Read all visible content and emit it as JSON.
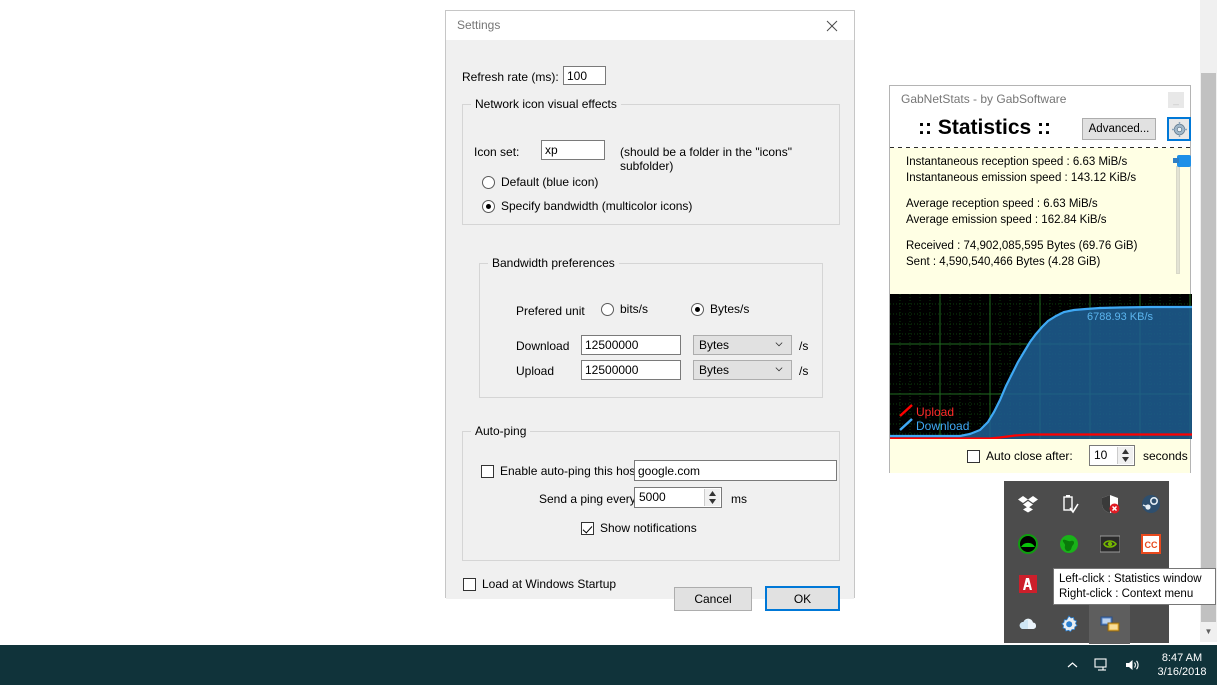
{
  "settings_dialog": {
    "title": "Settings",
    "close_icon": "close-icon",
    "refresh_rate_label": "Refresh rate (ms):",
    "refresh_rate_value": "100",
    "network_group": {
      "title": "Network icon visual effects",
      "icon_set_label": "Icon set:",
      "icon_set_value": "xp",
      "icon_set_hint": "(should be a folder in the \"icons\" subfolder)",
      "radio_default_label": "Default (blue icon)",
      "radio_specify_label": "Specify bandwidth (multicolor icons)",
      "selected": "specify"
    },
    "bandwidth_group": {
      "title": "Bandwidth preferences",
      "preferred_unit_label": "Prefered unit",
      "unit_bits_label": "bits/s",
      "unit_bytes_label": "Bytes/s",
      "unit_selected": "bytes",
      "download_label": "Download",
      "download_value": "12500000",
      "download_unit": "Bytes",
      "download_suffix": "/s",
      "upload_label": "Upload",
      "upload_value": "12500000",
      "upload_unit": "Bytes",
      "upload_suffix": "/s"
    },
    "autoping_group": {
      "title": "Auto-ping",
      "enable_label": "Enable auto-ping this host:",
      "enable_checked": false,
      "host_value": "google.com",
      "interval_label": "Send a ping every",
      "interval_value": "5000",
      "interval_unit": "ms",
      "notifications_label": "Show notifications",
      "notifications_checked": true
    },
    "footer": {
      "startup_label": "Load at Windows Startup",
      "startup_checked": false,
      "cancel_label": "Cancel",
      "ok_label": "OK"
    }
  },
  "stats_window": {
    "titlebar": "GabNetStats - by GabSoftware",
    "minimize_icon": "minimize-icon",
    "heading": ":: Statistics ::",
    "advanced_label": "Advanced...",
    "settings_icon": "gear-icon",
    "lines": [
      "Instantaneous reception speed : 6.63 MiB/s",
      "Instantaneous emission speed : 143.12 KiB/s",
      "Average reception speed : 6.63 MiB/s",
      "Average emission speed : 162.84 KiB/s",
      "Received : 74,902,085,595 Bytes (69.76 GiB)",
      "Sent : 4,590,540,466 Bytes (4.28 GiB)"
    ],
    "graph": {
      "peak_label": "6788.93 KB/s",
      "legend_upload": "Upload",
      "legend_download": "Download",
      "upload_color": "#ff0000",
      "download_color": "#3fa9f5",
      "grid_color": "#1f6b1f",
      "background_color": "#000000"
    },
    "footer": {
      "auto_close_label": "Auto close after:",
      "auto_close_checked": false,
      "auto_close_value": "10",
      "auto_close_unit": "seconds"
    }
  },
  "tray": {
    "icons": [
      "dropbox-icon",
      "usb-eject-icon",
      "security-shield-error-icon",
      "steam-icon",
      "teamviewer-icon",
      "green-globe-icon",
      "nvidia-icon",
      "ccleaner-icon",
      "adobe-icon",
      "blank-1",
      "blank-2",
      "blank-3",
      "onedrive-icon",
      "settings-gear-blue-icon",
      "gabnetstats-icon"
    ],
    "selected_icon": "gabnetstats-icon"
  },
  "tooltip": {
    "line1": "Left-click : Statistics window",
    "line2": "Right-click : Context menu"
  },
  "taskbar": {
    "show_hidden_icon": "chevron-up-icon",
    "network_icon": "network-icon",
    "volume_icon": "volume-icon",
    "time": "8:47 AM",
    "date": "3/16/2018",
    "background_color": "#10333a"
  },
  "page_scrollbar": {
    "down_arrow_icon": "chevron-down-icon"
  }
}
